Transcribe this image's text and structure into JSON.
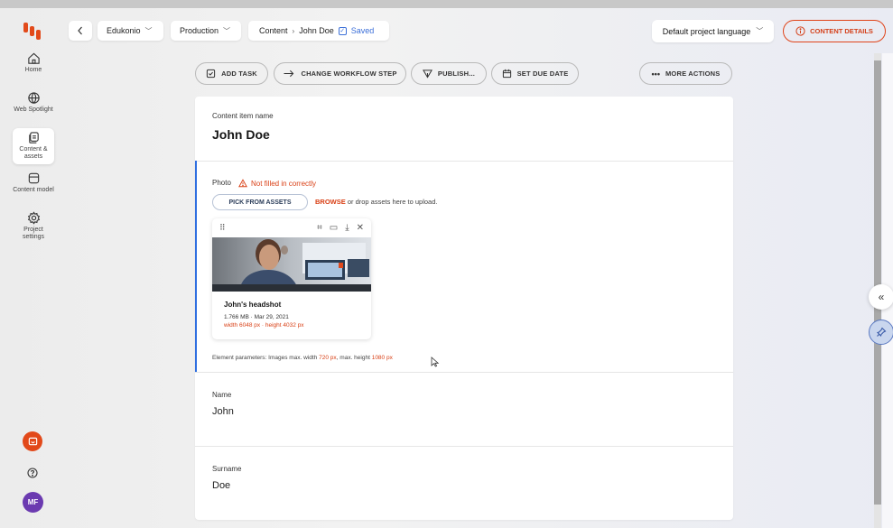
{
  "sidebar": {
    "items": [
      {
        "label": "Home",
        "icon": "home-icon"
      },
      {
        "label": "Web Spotlight",
        "icon": "globe-icon"
      },
      {
        "label": "Content & assets",
        "icon": "content-icon"
      },
      {
        "label": "Content model",
        "icon": "model-icon"
      },
      {
        "label": "Project settings",
        "icon": "gear-icon"
      }
    ],
    "avatar_initials": "MF"
  },
  "topbar": {
    "project": "Edukonio",
    "environment": "Production",
    "crumb_section": "Content",
    "crumb_item": "John Doe",
    "saved_label": "Saved",
    "language": "Default project language",
    "content_details": "CONTENT DETAILS"
  },
  "actions": {
    "add_task": "ADD TASK",
    "change_workflow": "CHANGE WORKFLOW STEP",
    "publish": "PUBLISH...",
    "set_due_date": "SET DUE DATE",
    "more_actions": "MORE ACTIONS"
  },
  "item": {
    "name_label": "Content item name",
    "name": "John Doe",
    "photo": {
      "label": "Photo",
      "warning": "Not filled in correctly",
      "pick_label": "PICK FROM ASSETS",
      "browse_label": "BROWSE",
      "upload_hint": " or drop assets here to upload.",
      "asset": {
        "title": "John's headshot",
        "meta": "1.766 MB · Mar 29, 2021",
        "dims": "width 6048 px · height 4032 px"
      },
      "params_prefix": "Element parameters: Images max. width ",
      "max_width": "720 px",
      "params_mid": ", max. height ",
      "max_height": "1080 px"
    },
    "name_field": {
      "label": "Name",
      "value": "John"
    },
    "surname_field": {
      "label": "Surname",
      "value": "Doe"
    }
  },
  "colors": {
    "accent": "#e2491a",
    "link_blue": "#3b6fd8",
    "avatar": "#6b3ab0"
  }
}
